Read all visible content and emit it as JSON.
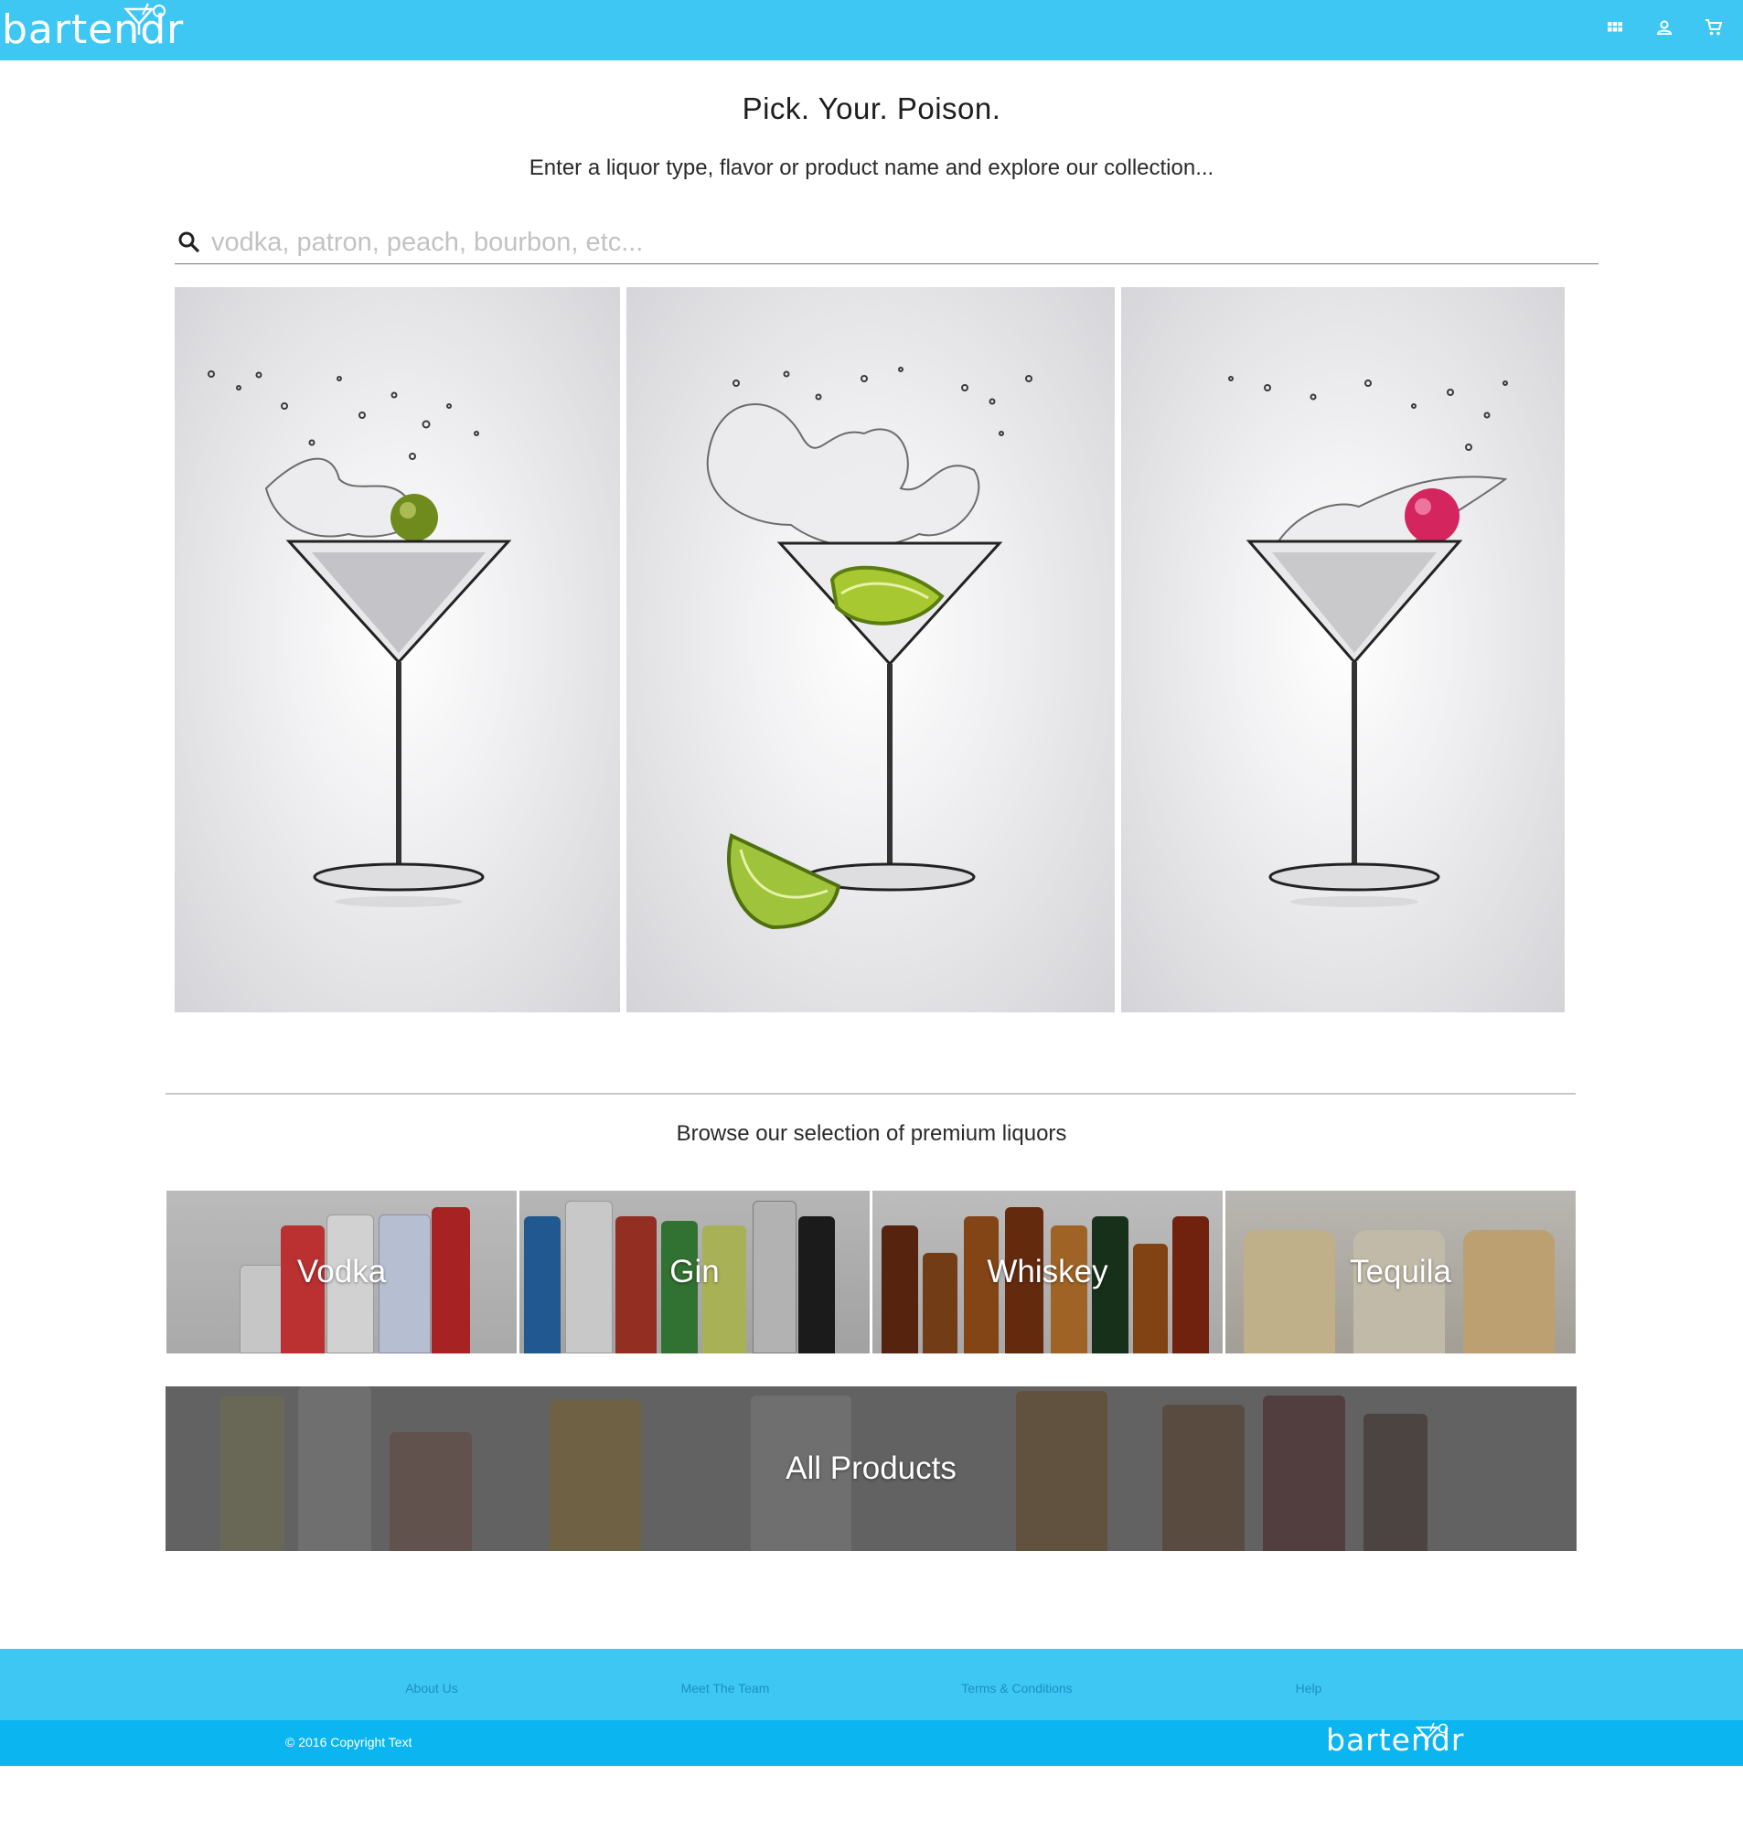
{
  "header": {
    "logo_text": "bartendr",
    "icons": [
      "apps-grid-icon",
      "account-icon",
      "cart-icon"
    ],
    "brand_color": "#3fc7f4"
  },
  "hero": {
    "title": "Pick. Your. Poison.",
    "subtitle": "Enter a liquor type, flavor or product name and explore our collection..."
  },
  "search": {
    "placeholder": "vodka, patron, peach, bourbon, etc...",
    "value": ""
  },
  "images": [
    "martini-with-olive",
    "martini-with-lime",
    "martini-with-cherry"
  ],
  "browse": {
    "heading": "Browse our selection of premium liquors",
    "categories": [
      {
        "label": "Vodka"
      },
      {
        "label": "Gin"
      },
      {
        "label": "Whiskey"
      },
      {
        "label": "Tequila"
      }
    ],
    "all_products": "All Products"
  },
  "footer": {
    "links": [
      {
        "label": "About Us"
      },
      {
        "label": "Meet The Team"
      },
      {
        "label": "Terms & Conditions"
      },
      {
        "label": "Help"
      }
    ],
    "copyright": "© 2016 Copyright Text",
    "logo_text": "bartendr",
    "footer_color": "#3fc7f4",
    "footer_bar_color": "#0bb5f0"
  }
}
